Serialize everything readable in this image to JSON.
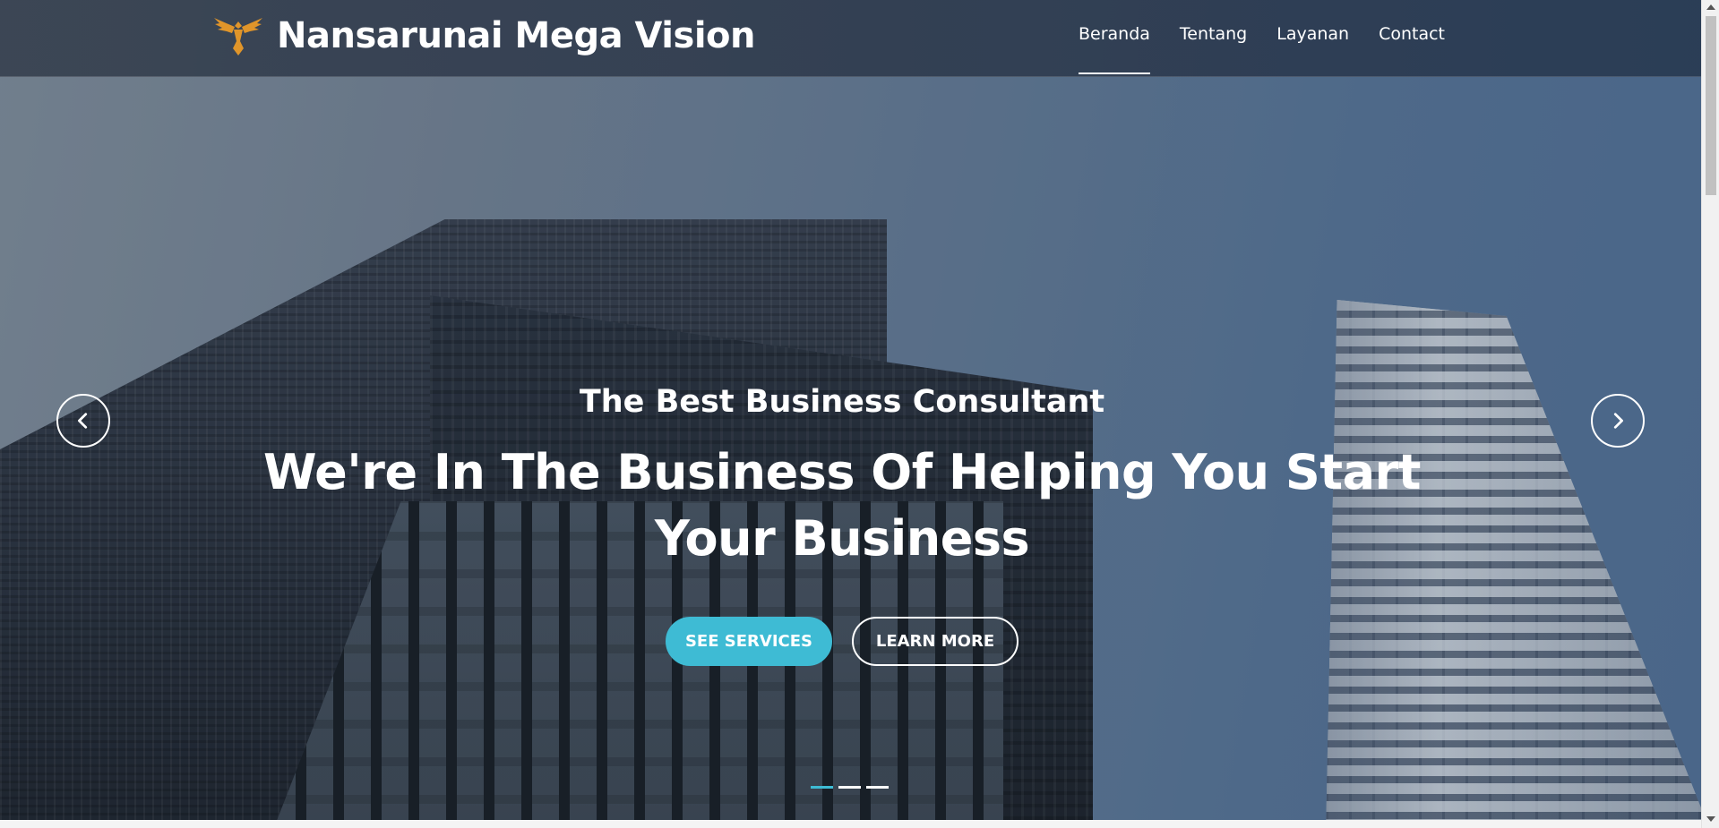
{
  "brand": {
    "name": "Nansarunai Mega Vision",
    "icon": "eagle-logo-icon",
    "icon_color": "#e0952a"
  },
  "nav": {
    "items": [
      {
        "label": "Beranda",
        "active": true
      },
      {
        "label": "Tentang",
        "active": false
      },
      {
        "label": "Layanan",
        "active": false
      },
      {
        "label": "Contact",
        "active": false
      }
    ]
  },
  "hero": {
    "subtitle": "The Best Business Consultant",
    "title": "We're In The Business Of Helping You Start Your Business",
    "buttons": {
      "primary": "SEE SERVICES",
      "secondary": "LEARN MORE"
    }
  },
  "carousel": {
    "prev_icon": "chevron-left-icon",
    "next_icon": "chevron-right-icon",
    "slide_count": 3,
    "active_slide": 1
  },
  "colors": {
    "accent": "#3ebbd4",
    "header_bg": "#3a4658",
    "text": "#ffffff"
  }
}
